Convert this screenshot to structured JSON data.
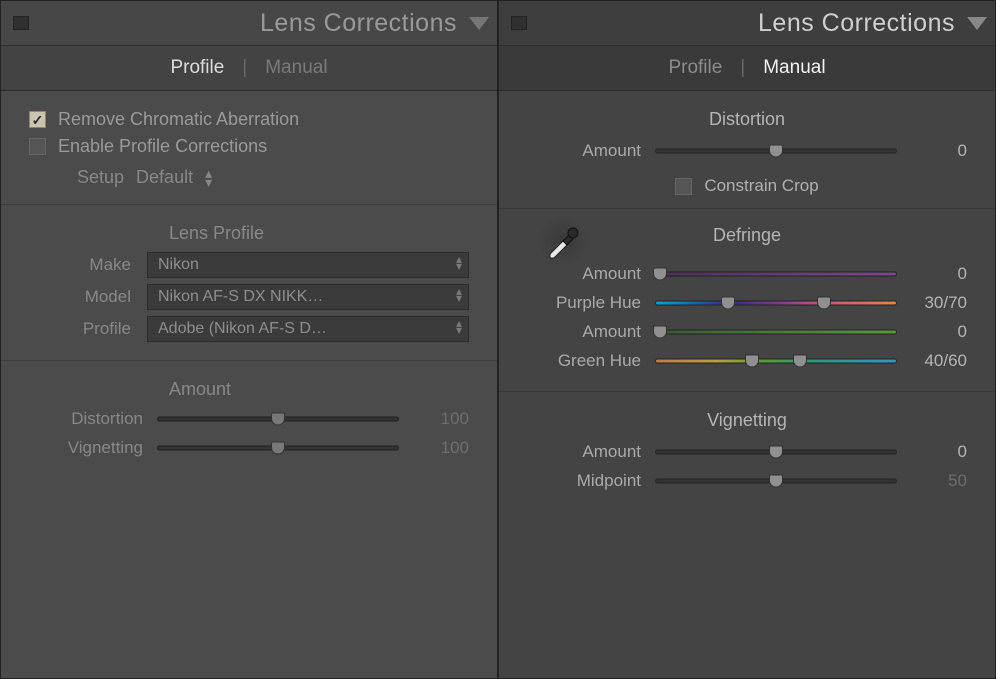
{
  "left": {
    "title": "Lens Corrections",
    "tabs": {
      "profile": "Profile",
      "manual": "Manual",
      "active": "profile"
    },
    "chk_remove_ca": {
      "label": "Remove Chromatic Aberration",
      "checked": true
    },
    "chk_enable_profile": {
      "label": "Enable Profile Corrections",
      "checked": false
    },
    "setup": {
      "label": "Setup",
      "value": "Default"
    },
    "lens_profile_heading": "Lens Profile",
    "make": {
      "label": "Make",
      "value": "Nikon"
    },
    "model": {
      "label": "Model",
      "value": "Nikon AF-S DX NIKK…"
    },
    "profile": {
      "label": "Profile",
      "value": "Adobe (Nikon AF-S D…"
    },
    "amount_heading": "Amount",
    "distortion": {
      "label": "Distortion",
      "value": "100",
      "pos": 50
    },
    "vignetting": {
      "label": "Vignetting",
      "value": "100",
      "pos": 50
    }
  },
  "right": {
    "title": "Lens Corrections",
    "tabs": {
      "profile": "Profile",
      "manual": "Manual",
      "active": "manual"
    },
    "distortion_heading": "Distortion",
    "distortion": {
      "label": "Amount",
      "value": "0",
      "pos": 50
    },
    "constrain_crop": {
      "label": "Constrain Crop",
      "checked": false
    },
    "defringe_heading": "Defringe",
    "purple_amount": {
      "label": "Amount",
      "value": "0",
      "pos": 2
    },
    "purple_hue": {
      "label": "Purple Hue",
      "value": "30/70",
      "lo": 30,
      "hi": 70
    },
    "green_amount": {
      "label": "Amount",
      "value": "0",
      "pos": 2
    },
    "green_hue": {
      "label": "Green Hue",
      "value": "40/60",
      "lo": 40,
      "hi": 60
    },
    "vignetting_heading": "Vignetting",
    "vig_amount": {
      "label": "Amount",
      "value": "0",
      "pos": 50
    },
    "vig_midpoint": {
      "label": "Midpoint",
      "value": "50",
      "pos": 50,
      "dim": true
    }
  }
}
